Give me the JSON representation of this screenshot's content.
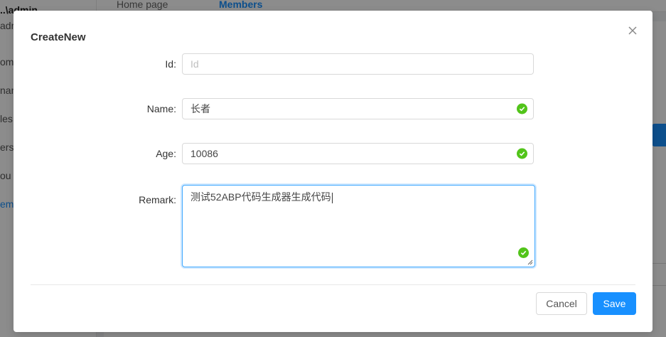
{
  "background": {
    "user": "..\\admin",
    "user_sub": "adr",
    "nav_items": [
      "ome",
      "nan",
      "les",
      "ers",
      "ou",
      "emb"
    ],
    "tabs": [
      "Home page",
      "Members"
    ]
  },
  "modal": {
    "title": "CreateNew",
    "close_icon": "close-icon",
    "fields": {
      "id": {
        "label": "Id:",
        "value": "",
        "placeholder": "Id"
      },
      "name": {
        "label": "Name:",
        "value": "长者",
        "valid": true
      },
      "age": {
        "label": "Age:",
        "value": "10086",
        "valid": true
      },
      "remark": {
        "label": "Remark:",
        "value": "测试52ABP代码生成器生成代码",
        "valid": true
      }
    },
    "buttons": {
      "cancel": "Cancel",
      "save": "Save"
    }
  },
  "colors": {
    "primary": "#1890ff",
    "success": "#52c41a"
  }
}
